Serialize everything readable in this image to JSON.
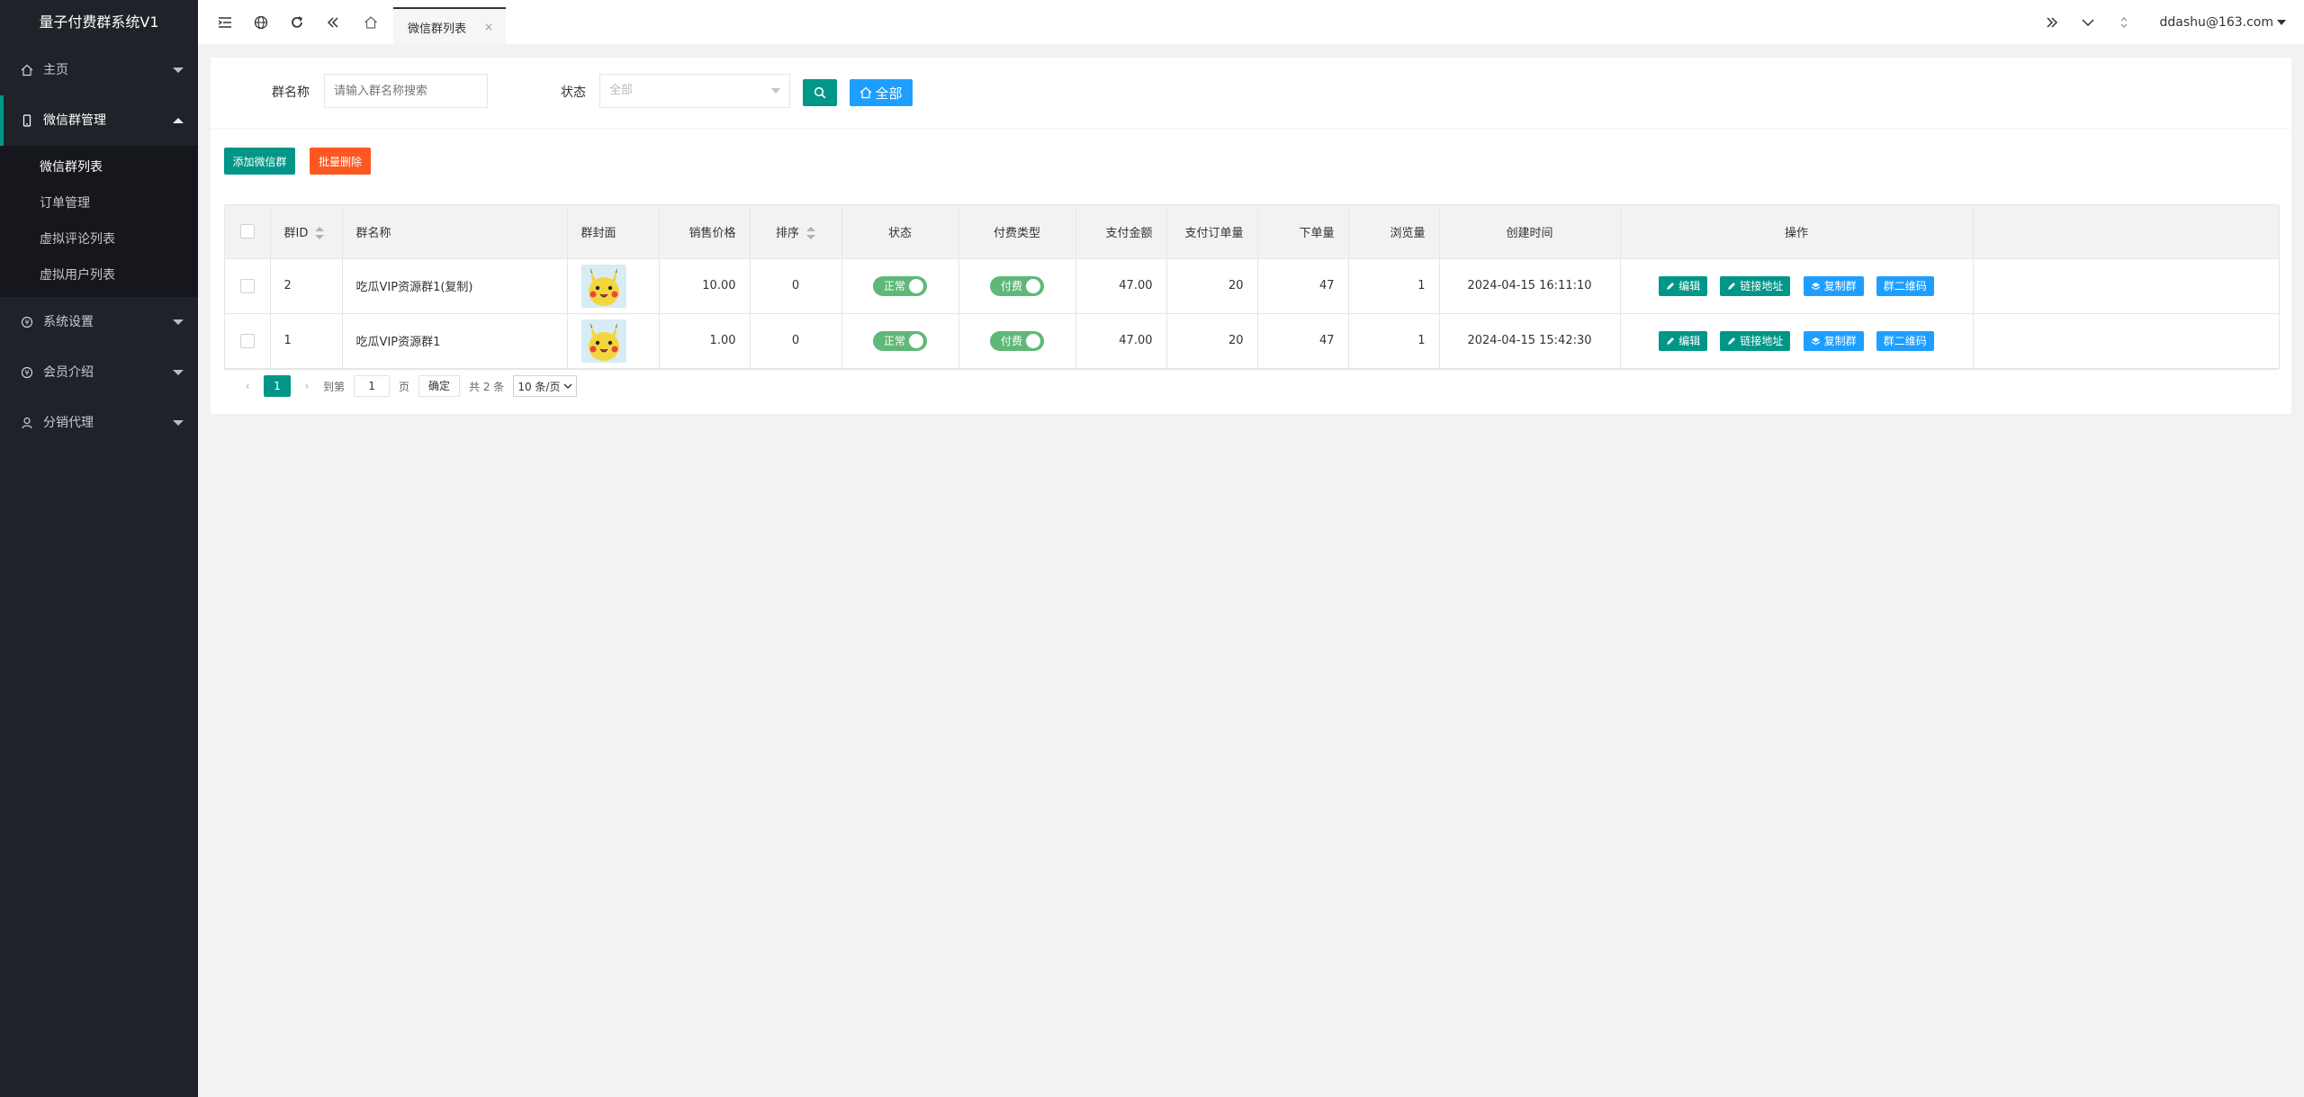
{
  "app": {
    "title": "量子付费群系统V1"
  },
  "colors": {
    "sidebar_bg": "#20222a",
    "accent_green": "#009688",
    "danger_orange": "#ff5722",
    "info_blue": "#1e9fff",
    "switch_green": "#5fb878"
  },
  "sidebar": {
    "items": [
      {
        "label": "主页",
        "icon": "home-icon"
      },
      {
        "label": "微信群管理",
        "icon": "mobile-icon",
        "open": true,
        "children": [
          {
            "label": "微信群列表",
            "active": true
          },
          {
            "label": "订单管理"
          },
          {
            "label": "虚拟评论列表"
          },
          {
            "label": "虚拟用户列表"
          }
        ]
      },
      {
        "label": "系统设置",
        "icon": "settings-icon"
      },
      {
        "label": "会员介绍",
        "icon": "member-icon"
      },
      {
        "label": "分销代理",
        "icon": "user-icon"
      }
    ]
  },
  "header": {
    "tab_label": "微信群列表",
    "tab_close": "×",
    "user": "ddashu@163.com"
  },
  "search": {
    "name_label": "群名称",
    "name_placeholder": "请输入群名称搜索",
    "status_label": "状态",
    "status_value": "全部",
    "all_button": "全部"
  },
  "toolbar": {
    "add_label": "添加微信群",
    "batch_delete_label": "批量删除"
  },
  "table": {
    "columns": [
      "群ID",
      "群名称",
      "群封面",
      "销售价格",
      "排序",
      "状态",
      "付费类型",
      "支付金额",
      "支付订单量",
      "下单量",
      "浏览量",
      "创建时间",
      "操作"
    ],
    "rows": [
      {
        "id": "2",
        "name": "吃瓜VIP资源群1(复制)",
        "price": "10.00",
        "sort": "0",
        "status": "正常",
        "pay_type": "付费",
        "pay_amount": "47.00",
        "pay_orders": "20",
        "orders": "47",
        "views": "1",
        "created": "2024-04-15 16:11:10"
      },
      {
        "id": "1",
        "name": "吃瓜VIP资源群1",
        "price": "1.00",
        "sort": "0",
        "status": "正常",
        "pay_type": "付费",
        "pay_amount": "47.00",
        "pay_orders": "20",
        "orders": "47",
        "views": "1",
        "created": "2024-04-15 15:42:30"
      }
    ],
    "actions": {
      "edit": "编辑",
      "link": "链接地址",
      "copy": "复制群",
      "qrcode": "群二维码"
    }
  },
  "pagination": {
    "current": "1",
    "goto_label": "到第",
    "goto_value": "1",
    "page_unit": "页",
    "confirm": "确定",
    "total": "共 2 条",
    "limit": "10 条/页"
  }
}
